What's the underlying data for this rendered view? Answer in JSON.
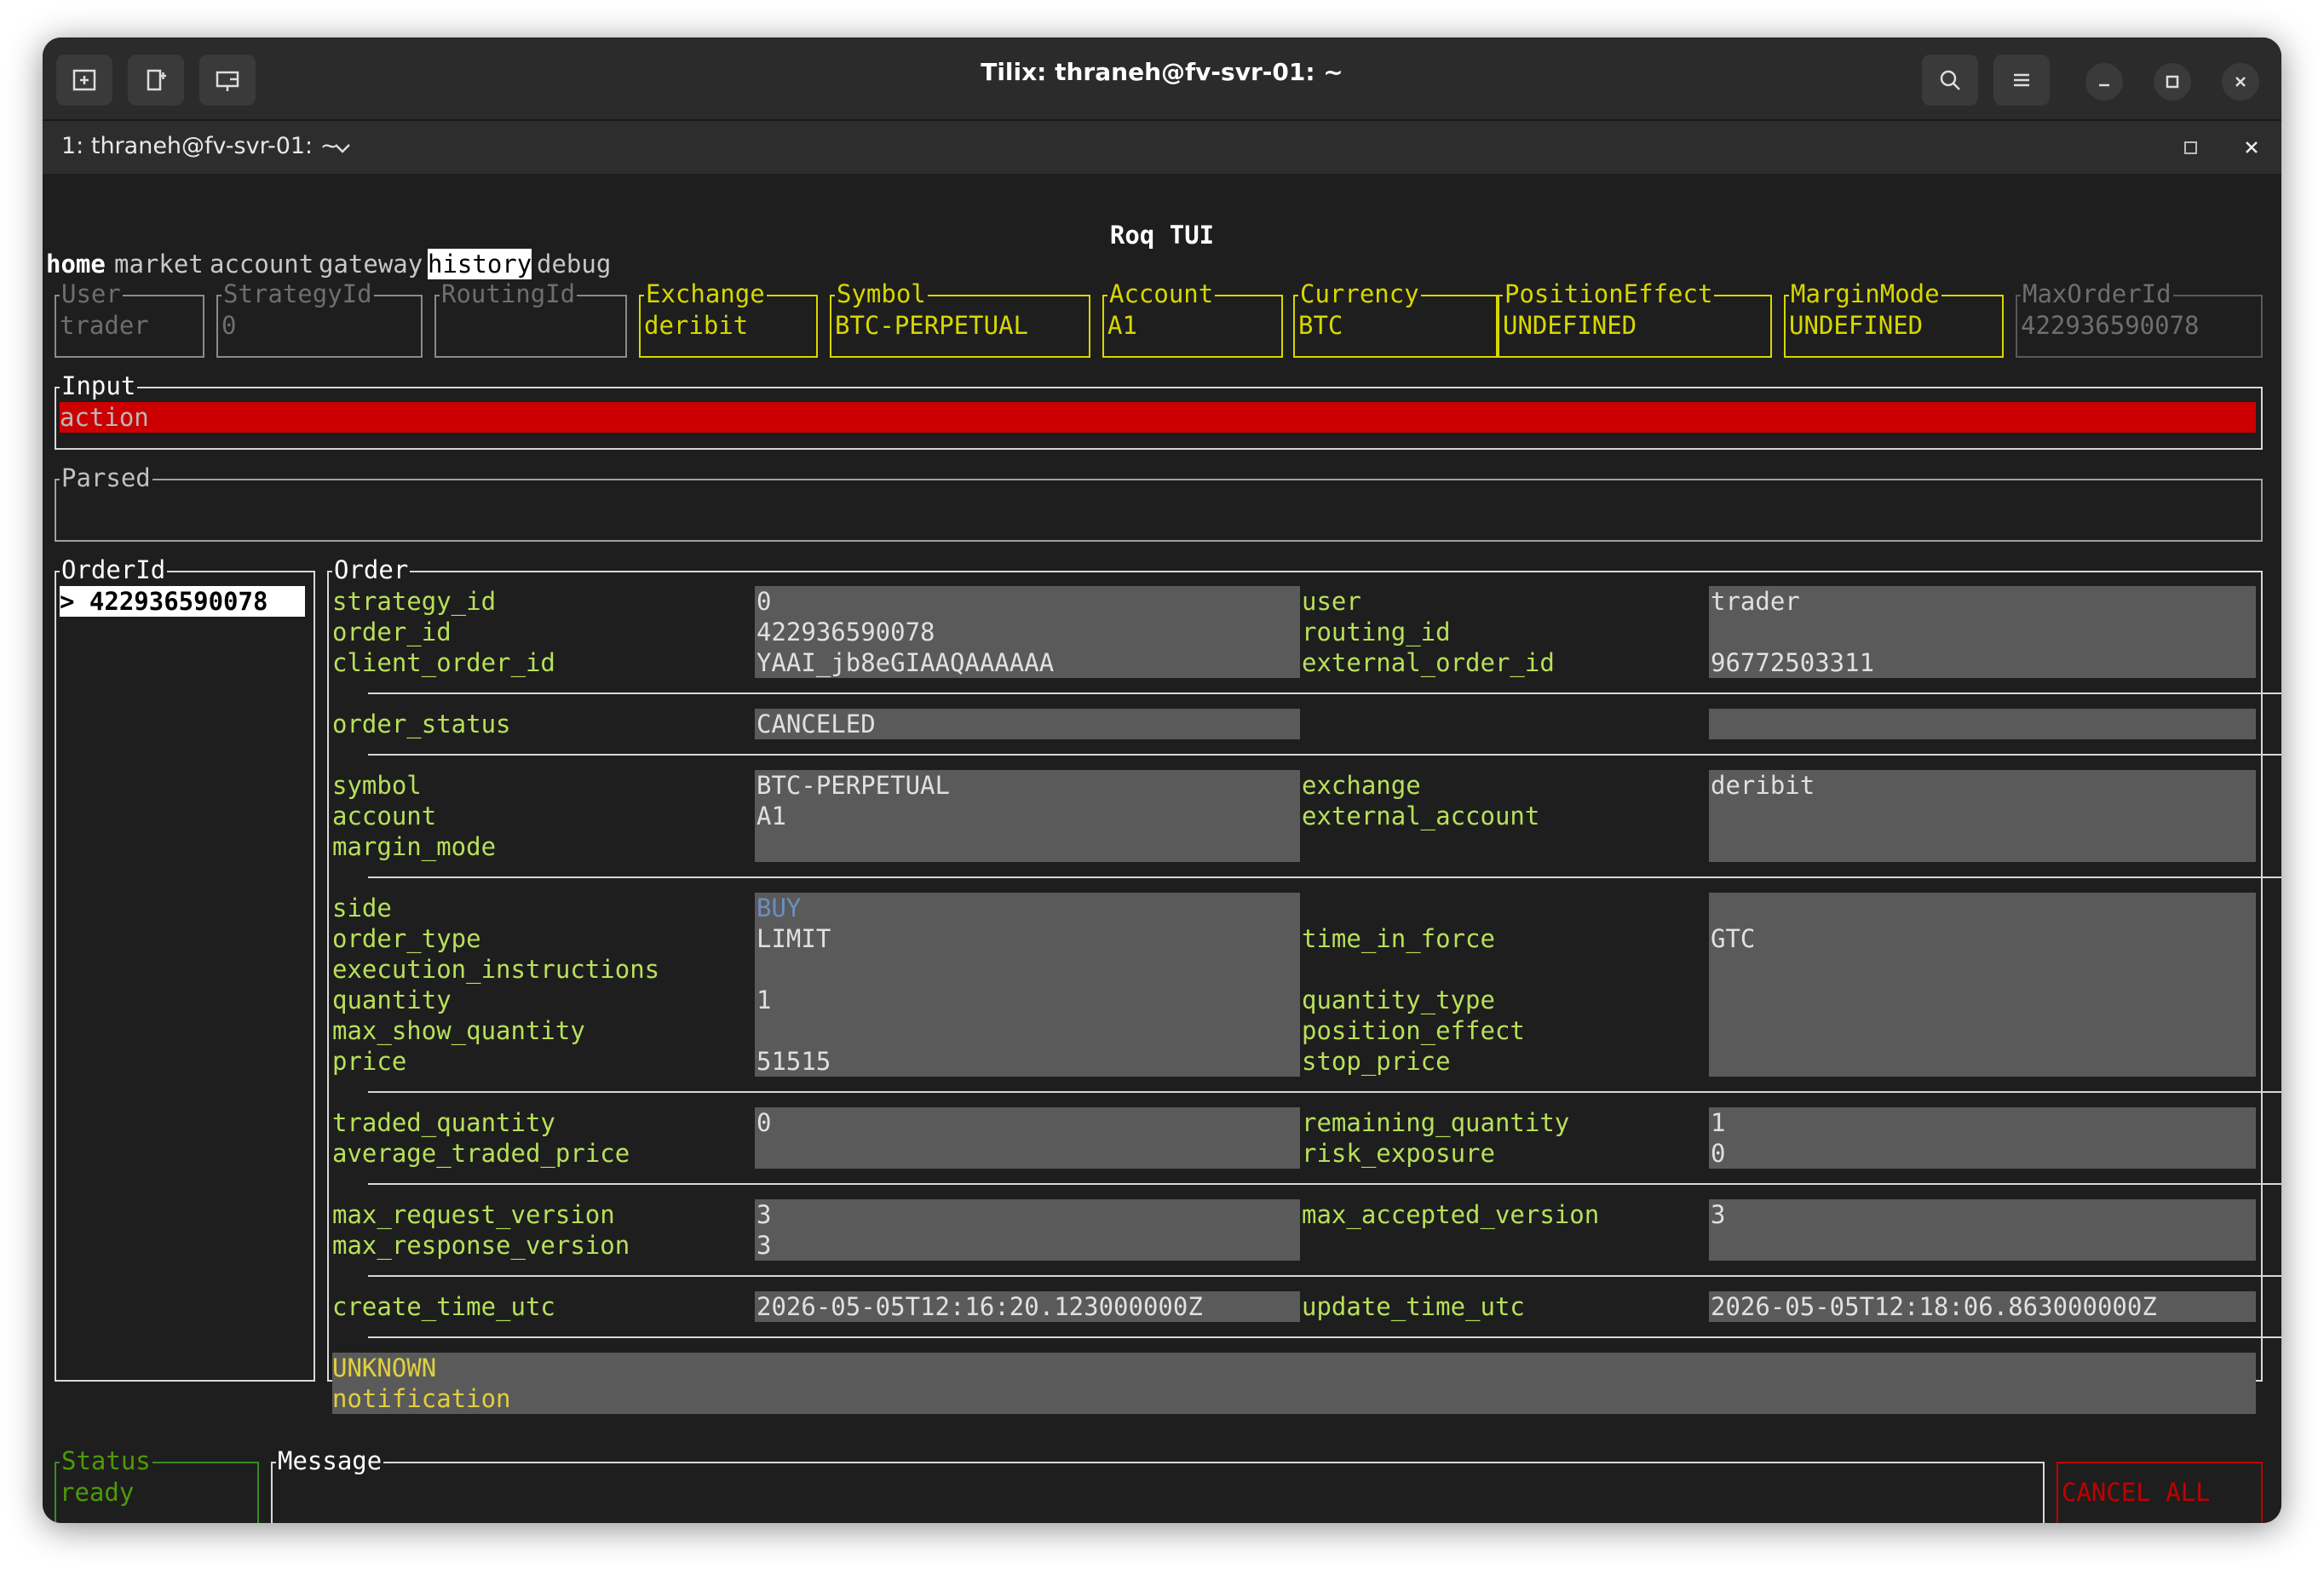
{
  "window": {
    "title": "Tilix: thraneh@fv-svr-01: ~",
    "tab_title": "1: thraneh@fv-svr-01: ~"
  },
  "app": {
    "title": "Roq TUI",
    "menu": [
      "home",
      "market",
      "account",
      "gateway",
      "history",
      "debug"
    ],
    "active_menu": "history"
  },
  "fields": {
    "user": {
      "label": "User",
      "value": "trader"
    },
    "strategy_id": {
      "label": "StrategyId",
      "value": "0"
    },
    "routing_id": {
      "label": "RoutingId",
      "value": ""
    },
    "exchange": {
      "label": "Exchange",
      "value": "deribit"
    },
    "symbol": {
      "label": "Symbol",
      "value": "BTC-PERPETUAL"
    },
    "account": {
      "label": "Account",
      "value": "A1"
    },
    "currency": {
      "label": "Currency",
      "value": "BTC"
    },
    "position_effect": {
      "label": "PositionEffect",
      "value": "UNDEFINED"
    },
    "margin_mode": {
      "label": "MarginMode",
      "value": "UNDEFINED"
    },
    "max_order_id": {
      "label": "MaxOrderId",
      "value": "422936590078"
    }
  },
  "input": {
    "label": "Input",
    "value": "action"
  },
  "parsed": {
    "label": "Parsed",
    "value": ""
  },
  "order_list": {
    "label": "OrderId",
    "items": [
      "> 422936590078"
    ]
  },
  "order": {
    "label": "Order",
    "strategy_id": {
      "key": "strategy_id",
      "value": "0"
    },
    "order_id": {
      "key": "order_id",
      "value": "422936590078"
    },
    "client_order_id": {
      "key": "client_order_id",
      "value": "YAAI_jb8eGIAAQAAAAAA"
    },
    "user": {
      "key": "user",
      "value": "trader"
    },
    "routing_id": {
      "key": "routing_id",
      "value": ""
    },
    "external_order_id": {
      "key": "external_order_id",
      "value": "96772503311"
    },
    "order_status": {
      "key": "order_status",
      "value": "CANCELED"
    },
    "symbol": {
      "key": "symbol",
      "value": "BTC-PERPETUAL"
    },
    "account": {
      "key": "account",
      "value": "A1"
    },
    "margin_mode": {
      "key": "margin_mode",
      "value": ""
    },
    "exchange": {
      "key": "exchange",
      "value": "deribit"
    },
    "external_account": {
      "key": "external_account",
      "value": ""
    },
    "side": {
      "key": "side",
      "value": "BUY"
    },
    "order_type": {
      "key": "order_type",
      "value": "LIMIT"
    },
    "execution_instructions": {
      "key": "execution_instructions",
      "value": ""
    },
    "quantity": {
      "key": "quantity",
      "value": "1"
    },
    "max_show_quantity": {
      "key": "max_show_quantity",
      "value": ""
    },
    "price": {
      "key": "price",
      "value": "51515"
    },
    "time_in_force": {
      "key": "time_in_force",
      "value": "GTC"
    },
    "quantity_type": {
      "key": "quantity_type",
      "value": ""
    },
    "position_effect": {
      "key": "position_effect",
      "value": ""
    },
    "stop_price": {
      "key": "stop_price",
      "value": ""
    },
    "traded_quantity": {
      "key": "traded_quantity",
      "value": "0"
    },
    "average_traded_price": {
      "key": "average_traded_price",
      "value": ""
    },
    "remaining_quantity": {
      "key": "remaining_quantity",
      "value": "1"
    },
    "risk_exposure": {
      "key": "risk_exposure",
      "value": "0"
    },
    "max_request_version": {
      "key": "max_request_version",
      "value": "3"
    },
    "max_response_version": {
      "key": "max_response_version",
      "value": "3"
    },
    "max_accepted_version": {
      "key": "max_accepted_version",
      "value": "3"
    },
    "create_time_utc": {
      "key": "create_time_utc",
      "value": "2026-05-05T12:16:20.123000000Z"
    },
    "update_time_utc": {
      "key": "update_time_utc",
      "value": "2026-05-05T12:18:06.863000000Z"
    },
    "notice_status": "UNKNOWN",
    "notice_text": "notification"
  },
  "status": {
    "label": "Status",
    "value": "ready"
  },
  "message": {
    "label": "Message",
    "value": ""
  },
  "cancel_all": "CANCEL ALL",
  "colors": {
    "terminal_bg": "#1e1e1e",
    "key_green": "#b8e05a",
    "field_yellow": "#d7d700",
    "input_red": "#cc0000",
    "side_buy_blue": "#6b8ec0"
  }
}
